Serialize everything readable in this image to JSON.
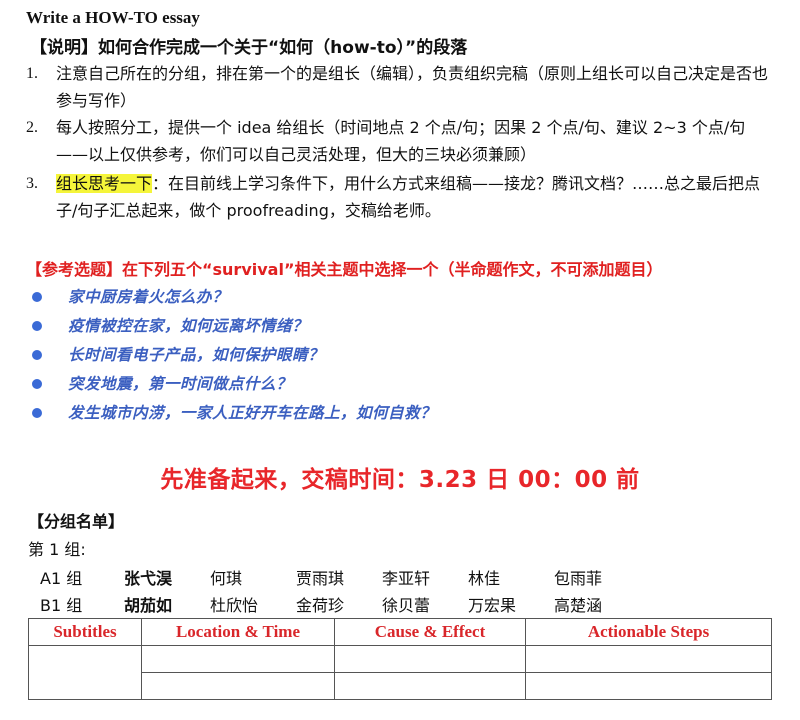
{
  "doc": {
    "title": "Write a HOW-TO essay",
    "instructions_heading": "【说明】如何合作完成一个关于“如何（how-to）”的段落",
    "rules": [
      {
        "num": "1.",
        "highlight": "",
        "text": "注意自己所在的分组，排在第一个的是组长（编辑），负责组织完稿（原则上组长可以自己决定是否也参与写作）"
      },
      {
        "num": "2.",
        "highlight": "",
        "text": "每人按照分工，提供一个 idea 给组长（时间地点 2 个点/句；因果 2 个点/句、建议 2~3 个点/句——以上仅供参考，你们可以自己灵活处理，但大的三块必须兼顾）"
      },
      {
        "num": "3.",
        "highlight": "组长思考一下",
        "text": "：在目前线上学习条件下，用什么方式来组稿——接龙？腾讯文档？……总之最后把点子/句子汇总起来，做个 proofreading，交稿给老师。"
      }
    ],
    "reference_heading": "【参考选题】在下列五个“survival”相关主题中选择一个（半命题作文，不可添加题目）",
    "topics": [
      "家中厨房着火怎么办？",
      "疫情被控在家，如何远离坏情绪？",
      "长时间看电子产品，如何保护眼睛？",
      "突发地震，第一时间做点什么？",
      "发生城市内涝，一家人正好开车在路上，如何自救？"
    ],
    "deadline": "先准备起来，交稿时间：3.23 日 00：00 前",
    "group_heading": "【分组名单】",
    "group_name": "第 1 组:",
    "subgroups": [
      {
        "label": "A1 组",
        "members": [
          "张弋淏",
          "何琪",
          "贾雨琪",
          "李亚轩",
          "林佳",
          "包雨菲"
        ]
      },
      {
        "label": "B1 组",
        "members": [
          "胡茄如",
          "杜欣怡",
          "金荷珍",
          "徐贝蕾",
          "万宏果",
          "高楚涵"
        ]
      }
    ],
    "table_headers": [
      "Subtitles",
      "Location & Time",
      "Cause & Effect",
      "Actionable Steps"
    ],
    "colors": {
      "heading_red": "#e02020",
      "topic_blue": "#3b5fc0",
      "highlight": "#f5f53a"
    }
  }
}
